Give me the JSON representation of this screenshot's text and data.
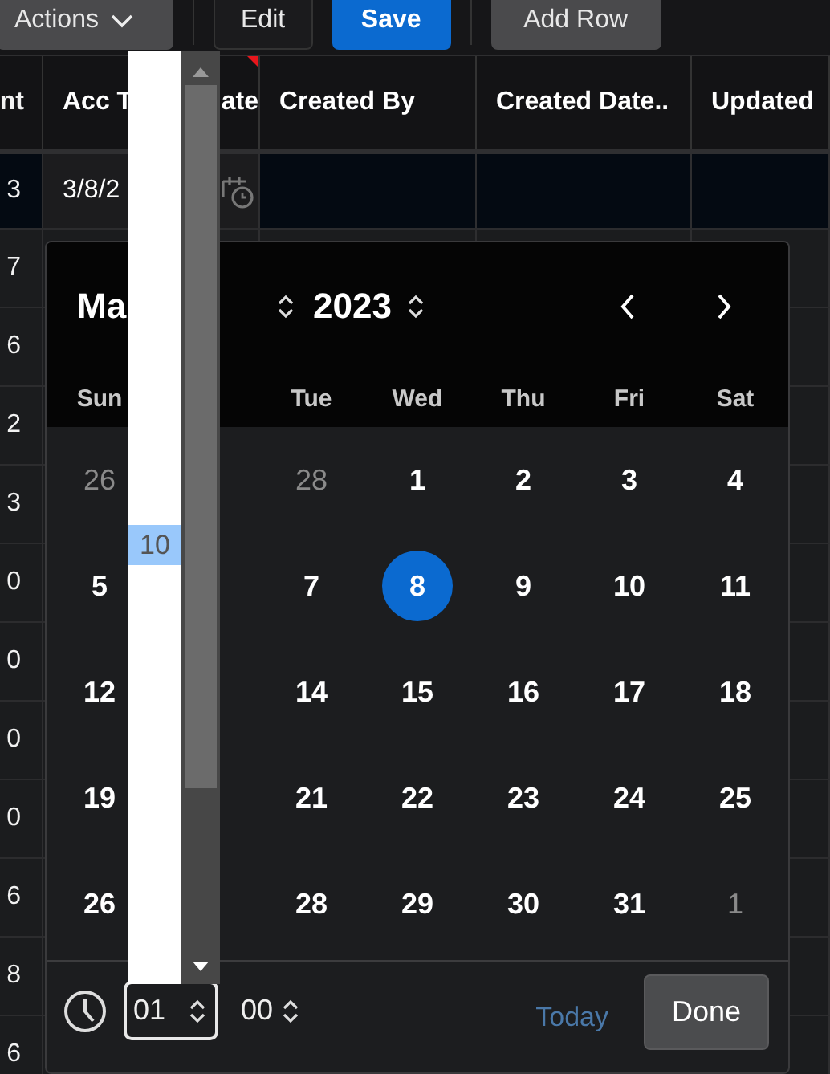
{
  "toolbar": {
    "buttons": [
      {
        "label": "Actions",
        "kind": "menu"
      },
      {
        "label": "Edit",
        "kind": "plain"
      },
      {
        "label": "Save",
        "kind": "primary"
      },
      {
        "label": "Add Row",
        "kind": "plain"
      }
    ]
  },
  "grid": {
    "columns": [
      {
        "label": "nt",
        "changed": false
      },
      {
        "label": "Acc T",
        "label_end": "ate",
        "changed": true
      },
      {
        "label": "Created By",
        "changed": false
      },
      {
        "label": "Created Date..",
        "changed": false
      },
      {
        "label": "Updated",
        "changed": false
      }
    ],
    "rows": [
      {
        "column_1": "3",
        "acc": "3/8/2",
        "selected": true
      },
      {
        "column_1": "7",
        "selected": false
      },
      {
        "column_1": "6",
        "selected": false
      },
      {
        "column_1": "2",
        "selected": false
      },
      {
        "column_1": "3",
        "selected": false
      },
      {
        "column_1": "0",
        "selected": false
      },
      {
        "column_1": "0",
        "selected": false
      },
      {
        "column_1": "0",
        "selected": false
      },
      {
        "column_1": "0",
        "selected": false
      },
      {
        "column_1": "6",
        "selected": false
      },
      {
        "column_1": "8",
        "selected": false
      },
      {
        "column_1": "6",
        "selected": false
      }
    ]
  },
  "calendar": {
    "month": "Ma",
    "year": "2023",
    "weekdays": {
      "sun": "Sun",
      "tue": "Tue",
      "wed": "Wed",
      "thu": "Thu",
      "fri": "Fri",
      "sat": "Sat"
    },
    "weeks": [
      {
        "sun": {
          "day": "26",
          "outside": true,
          "selected": false
        },
        "tue": {
          "day": "28",
          "outside": true,
          "selected": false
        },
        "wed": {
          "day": "1",
          "outside": false,
          "selected": false
        },
        "thu": {
          "day": "2",
          "outside": false,
          "selected": false
        },
        "fri": {
          "day": "3",
          "outside": false,
          "selected": false
        },
        "sat": {
          "day": "4",
          "outside": false,
          "selected": false
        }
      },
      {
        "sun": {
          "day": "5",
          "outside": false,
          "selected": false
        },
        "tue": {
          "day": "7",
          "outside": false,
          "selected": false
        },
        "wed": {
          "day": "8",
          "outside": false,
          "selected": true
        },
        "thu": {
          "day": "9",
          "outside": false,
          "selected": false
        },
        "fri": {
          "day": "10",
          "outside": false,
          "selected": false
        },
        "sat": {
          "day": "11",
          "outside": false,
          "selected": false
        }
      },
      {
        "sun": {
          "day": "12",
          "outside": false,
          "selected": false
        },
        "tue": {
          "day": "14",
          "outside": false,
          "selected": false
        },
        "wed": {
          "day": "15",
          "outside": false,
          "selected": false
        },
        "thu": {
          "day": "16",
          "outside": false,
          "selected": false
        },
        "fri": {
          "day": "17",
          "outside": false,
          "selected": false
        },
        "sat": {
          "day": "18",
          "outside": false,
          "selected": false
        }
      },
      {
        "sun": {
          "day": "19",
          "outside": false,
          "selected": false
        },
        "tue": {
          "day": "21",
          "outside": false,
          "selected": false
        },
        "wed": {
          "day": "22",
          "outside": false,
          "selected": false
        },
        "thu": {
          "day": "23",
          "outside": false,
          "selected": false
        },
        "fri": {
          "day": "24",
          "outside": false,
          "selected": false
        },
        "sat": {
          "day": "25",
          "outside": false,
          "selected": false
        }
      },
      {
        "sun": {
          "day": "26",
          "outside": false,
          "selected": false
        },
        "tue": {
          "day": "28",
          "outside": false,
          "selected": false
        },
        "wed": {
          "day": "29",
          "outside": false,
          "selected": false
        },
        "thu": {
          "day": "30",
          "outside": false,
          "selected": false
        },
        "fri": {
          "day": "31",
          "outside": false,
          "selected": false
        },
        "sat": {
          "day": "1",
          "outside": true,
          "selected": false
        }
      }
    ],
    "time": {
      "hour": "01",
      "hour_focused": true,
      "minute": "00"
    },
    "today_link": "Today",
    "done_button": "Done"
  },
  "hour_dropdown": {
    "items": [
      {
        "label": "10",
        "selected": true
      }
    ]
  }
}
